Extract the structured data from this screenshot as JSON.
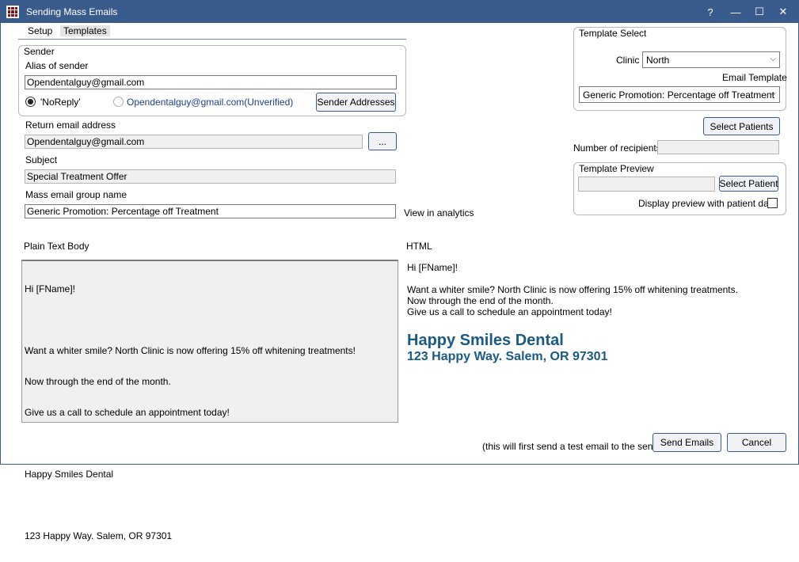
{
  "window": {
    "title": "Sending Mass Emails",
    "help_glyph": "?",
    "minimize_glyph": "—",
    "maximize_glyph": "☐",
    "close_glyph": "✕",
    "titlebar_color": "#3a5c8c"
  },
  "menu": {
    "items": [
      {
        "label": "Setup"
      },
      {
        "label": "Templates"
      }
    ]
  },
  "sender": {
    "group_title": "Sender",
    "alias_label": "Alias of sender",
    "alias_value": "Opendentalguy@gmail.com",
    "radio_noreply_label": "'NoReply'",
    "radio_address_label": "Opendentalguy@gmail.com(Unverified)",
    "sender_addresses_button": "Sender Addresses"
  },
  "return_email": {
    "label": "Return email address",
    "value": "Opendentalguy@gmail.com",
    "browse_button": "..."
  },
  "subject": {
    "label": "Subject",
    "value": "Special Treatment Offer"
  },
  "group_name": {
    "label": "Mass email group name",
    "value": "Generic Promotion: Percentage off Treatment",
    "analytics_link": "View in analytics"
  },
  "template_select": {
    "group_title": "Template Select",
    "clinic_label": "Clinic",
    "clinic_value": "North",
    "email_template_label": "Email Template",
    "email_template_value": "Generic Promotion: Percentage off Treatment"
  },
  "select_patients_button": "Select Patients",
  "recipients": {
    "label": "Number of recipients",
    "value": ""
  },
  "template_preview": {
    "group_title": "Template Preview",
    "patient_value": "",
    "select_patient_button": "Select Patient",
    "display_preview_label": "Display preview with patient data"
  },
  "plain_text": {
    "label": "Plain Text Body",
    "lines": [
      "Hi [FName]!",
      "",
      "Want a whiter smile? North Clinic is now offering 15% off whitening treatments!",
      "Now through the end of the month.",
      "Give us a call to schedule an appointment today!",
      "",
      "Happy Smiles Dental",
      "",
      "123 Happy Way. Salem, OR 97301"
    ]
  },
  "html_preview": {
    "label": "HTML",
    "lines": [
      "Hi [FName]!",
      "",
      "Want a whiter smile? North Clinic is now offering 15% off whitening treatments.",
      "Now through the end of the month.",
      "Give us a call to schedule an appointment today!"
    ],
    "heading": "Happy Smiles Dental",
    "address": "123 Happy Way. Salem, OR 97301",
    "heading_color": "#1a5a86"
  },
  "footer": {
    "note": "(this will first send a test email to the sender)",
    "send_button": "Send Emails",
    "cancel_button": "Cancel"
  }
}
